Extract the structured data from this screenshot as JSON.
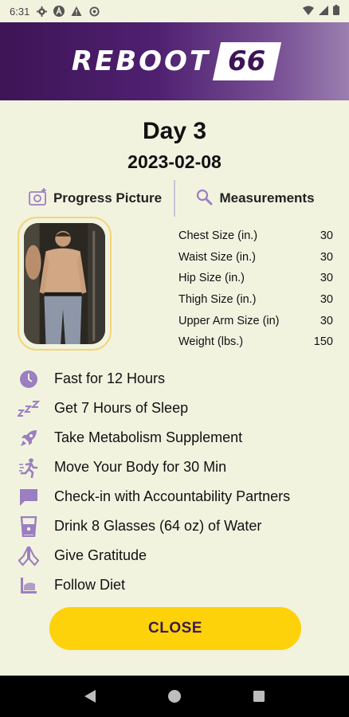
{
  "status_bar": {
    "time": "6:31",
    "icons": [
      "gear-icon",
      "a-icon",
      "warning-icon",
      "settings-icon"
    ],
    "right_icons": [
      "wifi-icon",
      "signal-icon",
      "battery-icon"
    ]
  },
  "header": {
    "logo_word": "REBOOT",
    "logo_number": "66",
    "background": "#4f2070"
  },
  "day": {
    "title": "Day 3",
    "date": "2023-02-08"
  },
  "tabs": {
    "progress_picture": "Progress Picture",
    "measurements": "Measurements"
  },
  "measurements": [
    {
      "label": "Chest Size (in.)",
      "value": "30"
    },
    {
      "label": "Waist Size (in.)",
      "value": "30"
    },
    {
      "label": "Hip Size (in.)",
      "value": "30"
    },
    {
      "label": "Thigh Size (in.)",
      "value": "30"
    },
    {
      "label": "Upper Arm Size (in)",
      "value": "30"
    },
    {
      "label": "Weight (lbs.)",
      "value": "150"
    }
  ],
  "tasks": [
    {
      "icon": "clock-icon",
      "label": "Fast for 12 Hours"
    },
    {
      "icon": "sleep-icon",
      "label": "Get 7 Hours of Sleep"
    },
    {
      "icon": "rocket-icon",
      "label": "Take Metabolism Supplement"
    },
    {
      "icon": "running-icon",
      "label": "Move Your Body for 30 Min"
    },
    {
      "icon": "chat-icon",
      "label": "Check-in with Accountability Partners"
    },
    {
      "icon": "glass-icon",
      "label": "Drink 8 Glasses (64 oz) of Water"
    },
    {
      "icon": "praying-hands-icon",
      "label": " Give Gratitude"
    },
    {
      "icon": "diet-icon",
      "label": "Follow Diet"
    }
  ],
  "close_button": {
    "label": "CLOSE",
    "color": "#fdd20a"
  },
  "accent_color": "#9b7fc0"
}
